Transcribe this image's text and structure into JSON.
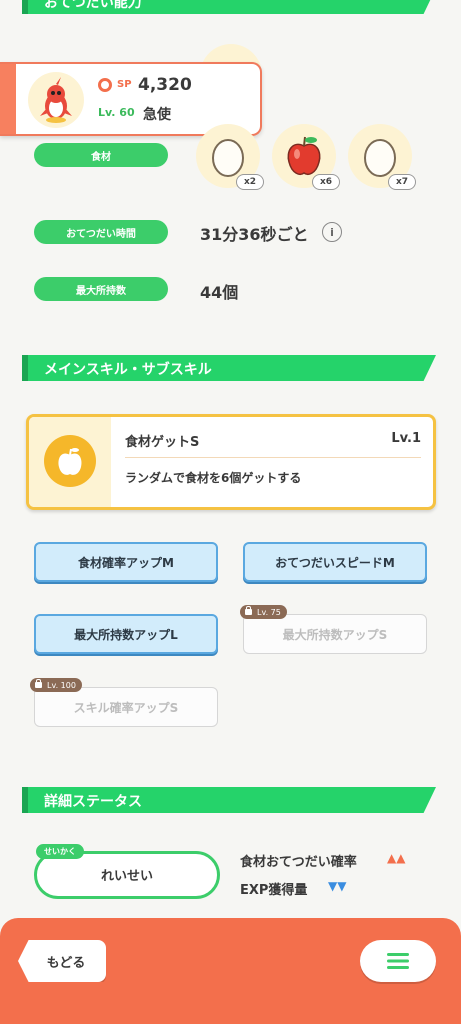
{
  "sections": {
    "help_ability": "おてつだい能力",
    "main_sub_skill": "メインスキル・サブスキル",
    "detail_status": "詳細ステータス"
  },
  "pokemon": {
    "sp_label": "SP",
    "sp_value": "4,320",
    "level": "Lv. 60",
    "nickname": "急使"
  },
  "help": {
    "ingredients_label": "食材",
    "ingredients": [
      {
        "icon": "egg-icon",
        "count": "x2"
      },
      {
        "icon": "apple-icon",
        "count": "x6"
      },
      {
        "icon": "egg-icon",
        "count": "x7"
      }
    ],
    "time_label": "おてつだい時間",
    "time_value": "31分36秒ごと",
    "info_glyph": "i",
    "max_carry_label": "最大所持数",
    "max_carry_value": "44個"
  },
  "main_skill": {
    "name": "食材ゲットS",
    "level": "Lv.1",
    "description": "ランダムで食材を6個ゲットする"
  },
  "sub_skills": [
    {
      "label": "食材確率アップM",
      "locked": false
    },
    {
      "label": "おてつだいスピードM",
      "locked": false
    },
    {
      "label": "最大所持数アップL",
      "locked": false
    },
    {
      "label": "最大所持数アップS",
      "locked": true,
      "unlock_level": "Lv. 75"
    },
    {
      "label": "スキル確率アップS",
      "locked": true,
      "unlock_level": "Lv. 100"
    }
  ],
  "nature": {
    "tag": "せいかく",
    "value": "れいせい",
    "effects": [
      {
        "label": "食材おてつだい確率",
        "direction": "up",
        "marks": "▲▲"
      },
      {
        "label": "EXP獲得量",
        "direction": "down",
        "marks": "▼▼"
      }
    ]
  },
  "nav": {
    "back_label": "もどる"
  },
  "colors": {
    "accent_green": "#25d36a",
    "accent_orange": "#f36f4c",
    "up_red": "#f36f4c",
    "down_blue": "#3a8de0"
  }
}
